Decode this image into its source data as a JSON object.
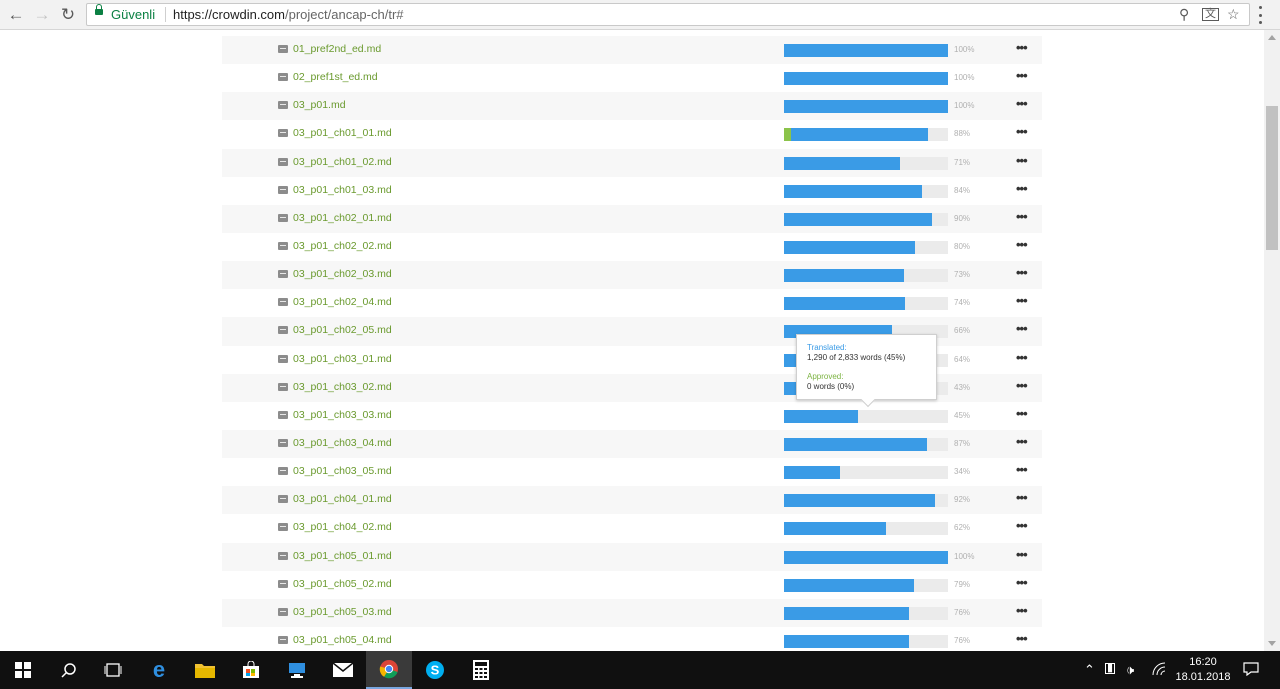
{
  "browser": {
    "back_icon": "back-arrow-icon",
    "forward_icon": "forward-arrow-icon",
    "reload_icon": "reload-icon",
    "secure_label": "Güvenli",
    "url_host": "https://crowdin.com",
    "url_path": "/project/ancap-ch/tr#",
    "omnibox_icons": [
      "zoom-icon",
      "translate-icon",
      "star-icon"
    ],
    "menu_icon": "kebab-menu-icon"
  },
  "files": [
    {
      "name": "01_pref2nd_ed.md",
      "translated": 100,
      "approved": 0,
      "pct_label": "100%"
    },
    {
      "name": "02_pref1st_ed.md",
      "translated": 100,
      "approved": 0,
      "pct_label": "100%"
    },
    {
      "name": "03_p01.md",
      "translated": 100,
      "approved": 0,
      "pct_label": "100%"
    },
    {
      "name": "03_p01_ch01_01.md",
      "translated": 88,
      "approved": 4,
      "pct_label": "88%"
    },
    {
      "name": "03_p01_ch01_02.md",
      "translated": 71,
      "approved": 0,
      "pct_label": "71%"
    },
    {
      "name": "03_p01_ch01_03.md",
      "translated": 84,
      "approved": 0,
      "pct_label": "84%"
    },
    {
      "name": "03_p01_ch02_01.md",
      "translated": 90,
      "approved": 0,
      "pct_label": "90%"
    },
    {
      "name": "03_p01_ch02_02.md",
      "translated": 80,
      "approved": 0,
      "pct_label": "80%"
    },
    {
      "name": "03_p01_ch02_03.md",
      "translated": 73,
      "approved": 0,
      "pct_label": "73%"
    },
    {
      "name": "03_p01_ch02_04.md",
      "translated": 74,
      "approved": 0,
      "pct_label": "74%"
    },
    {
      "name": "03_p01_ch02_05.md",
      "translated": 66,
      "approved": 0,
      "pct_label": "66%"
    },
    {
      "name": "03_p01_ch03_01.md",
      "translated": 64,
      "approved": 0,
      "pct_label": "64%"
    },
    {
      "name": "03_p01_ch03_02.md",
      "translated": 43,
      "approved": 0,
      "pct_label": "43%"
    },
    {
      "name": "03_p01_ch03_03.md",
      "translated": 45,
      "approved": 0,
      "pct_label": "45%"
    },
    {
      "name": "03_p01_ch03_04.md",
      "translated": 87,
      "approved": 0,
      "pct_label": "87%"
    },
    {
      "name": "03_p01_ch03_05.md",
      "translated": 34,
      "approved": 0,
      "pct_label": "34%"
    },
    {
      "name": "03_p01_ch04_01.md",
      "translated": 92,
      "approved": 0,
      "pct_label": "92%"
    },
    {
      "name": "03_p01_ch04_02.md",
      "translated": 62,
      "approved": 0,
      "pct_label": "62%"
    },
    {
      "name": "03_p01_ch05_01.md",
      "translated": 100,
      "approved": 0,
      "pct_label": "100%"
    },
    {
      "name": "03_p01_ch05_02.md",
      "translated": 79,
      "approved": 0,
      "pct_label": "79%"
    },
    {
      "name": "03_p01_ch05_03.md",
      "translated": 76,
      "approved": 0,
      "pct_label": "76%"
    },
    {
      "name": "03_p01_ch05_04.md",
      "translated": 76,
      "approved": 0,
      "pct_label": "76%"
    }
  ],
  "more_label": "•••",
  "tooltip": {
    "translated_label": "Translated:",
    "translated_value": "1,290 of 2,833 words (45%)",
    "approved_label": "Approved:",
    "approved_value": "0 words (0%)"
  },
  "taskbar": {
    "items": [
      "start-icon",
      "search-icon",
      "task-view-icon",
      "edge-icon",
      "file-explorer-icon",
      "store-icon",
      "remote-desktop-icon",
      "mail-icon",
      "chrome-icon",
      "skype-icon",
      "calculator-icon"
    ],
    "active_item": "chrome-icon",
    "time": "16:20",
    "date": "18.01.2018"
  },
  "colors": {
    "translated": "#3a9be6",
    "approved": "#8bc34a",
    "link": "#6a9a2e",
    "secure": "#0b8043"
  }
}
